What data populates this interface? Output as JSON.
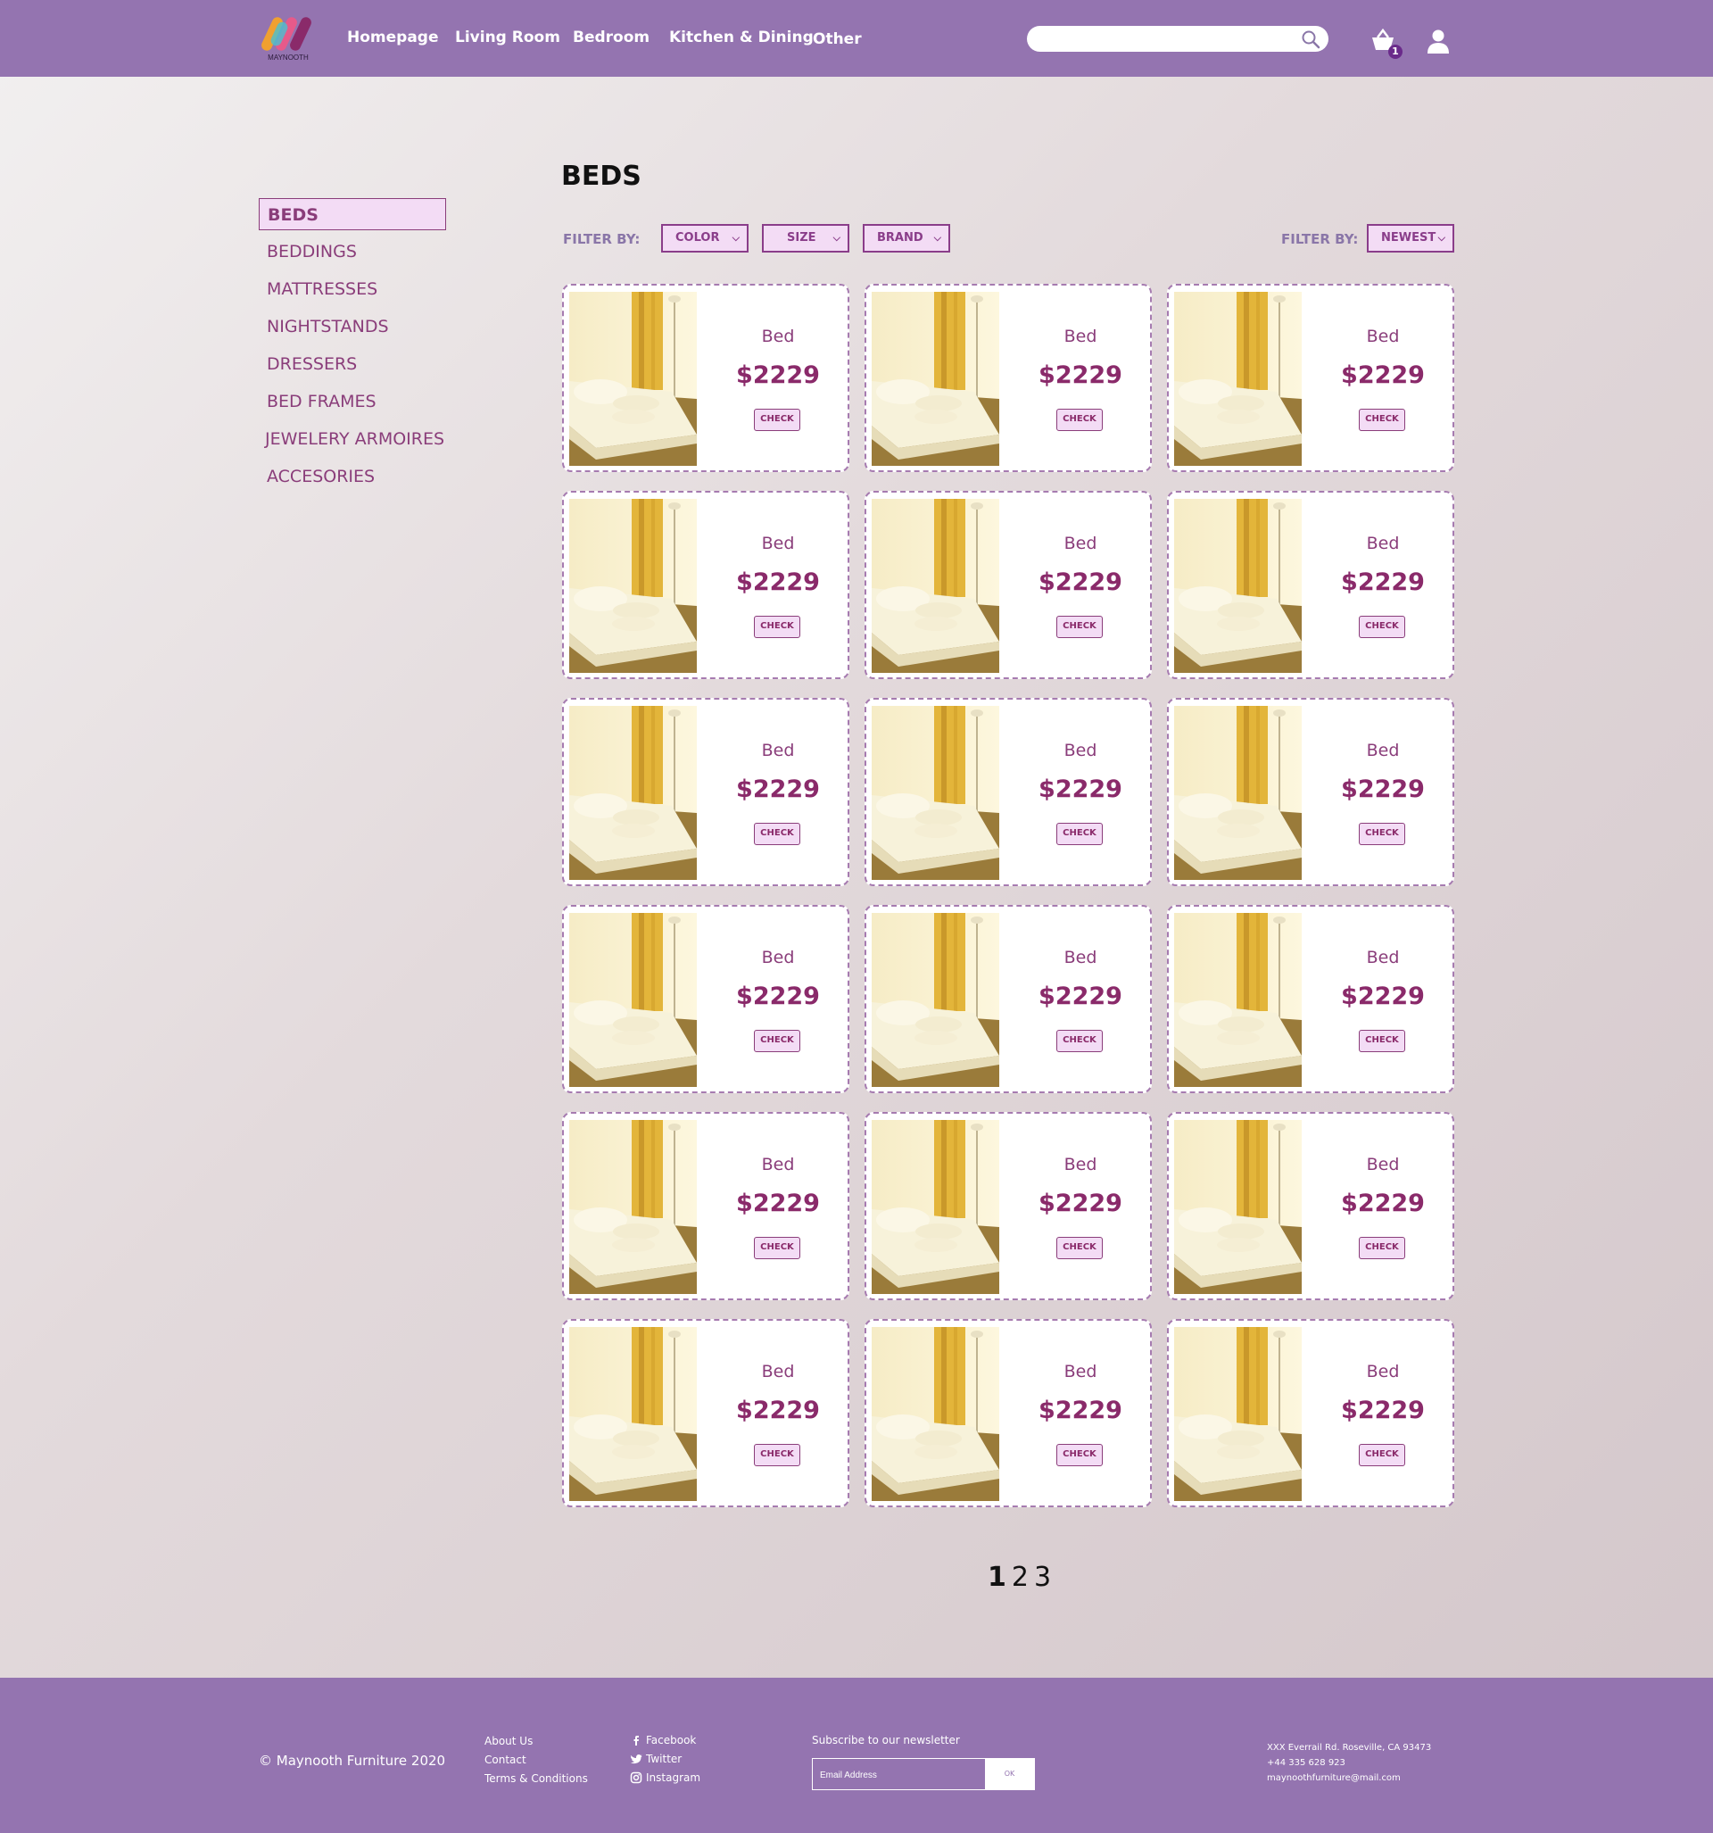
{
  "brand": {
    "name": "MAYNOOTH"
  },
  "nav": [
    {
      "label": "Homepage"
    },
    {
      "label": "Living Room"
    },
    {
      "label": "Bedroom"
    },
    {
      "label": "Kitchen & Dining"
    },
    {
      "label": "Other"
    }
  ],
  "search": {
    "placeholder": ""
  },
  "cart": {
    "count": "1"
  },
  "sidebar": {
    "items": [
      {
        "label": "BEDS",
        "active": true
      },
      {
        "label": "BEDDINGS"
      },
      {
        "label": "MATTRESSES"
      },
      {
        "label": "NIGHTSTANDS"
      },
      {
        "label": "DRESSERS"
      },
      {
        "label": "BED FRAMES"
      },
      {
        "label": "JEWELERY ARMOIRES"
      },
      {
        "label": "ACCESORIES"
      }
    ]
  },
  "main": {
    "title": "BEDS",
    "filter_label": "FILTER BY:",
    "filters": [
      {
        "label": "COLOR"
      },
      {
        "label": "SIZE"
      },
      {
        "label": "BRAND"
      }
    ],
    "sort_label": "FILTER BY:",
    "sort": {
      "label": "NEWEST"
    }
  },
  "products": [
    {
      "name": "Bed",
      "price": "$2229",
      "button": "CHECK"
    },
    {
      "name": "Bed",
      "price": "$2229",
      "button": "CHECK"
    },
    {
      "name": "Bed",
      "price": "$2229",
      "button": "CHECK"
    },
    {
      "name": "Bed",
      "price": "$2229",
      "button": "CHECK"
    },
    {
      "name": "Bed",
      "price": "$2229",
      "button": "CHECK"
    },
    {
      "name": "Bed",
      "price": "$2229",
      "button": "CHECK"
    },
    {
      "name": "Bed",
      "price": "$2229",
      "button": "CHECK"
    },
    {
      "name": "Bed",
      "price": "$2229",
      "button": "CHECK"
    },
    {
      "name": "Bed",
      "price": "$2229",
      "button": "CHECK"
    },
    {
      "name": "Bed",
      "price": "$2229",
      "button": "CHECK"
    },
    {
      "name": "Bed",
      "price": "$2229",
      "button": "CHECK"
    },
    {
      "name": "Bed",
      "price": "$2229",
      "button": "CHECK"
    },
    {
      "name": "Bed",
      "price": "$2229",
      "button": "CHECK"
    },
    {
      "name": "Bed",
      "price": "$2229",
      "button": "CHECK"
    },
    {
      "name": "Bed",
      "price": "$2229",
      "button": "CHECK"
    },
    {
      "name": "Bed",
      "price": "$2229",
      "button": "CHECK"
    },
    {
      "name": "Bed",
      "price": "$2229",
      "button": "CHECK"
    },
    {
      "name": "Bed",
      "price": "$2229",
      "button": "CHECK"
    }
  ],
  "pagination": {
    "pages": [
      "1",
      "2",
      "3"
    ],
    "current": "1"
  },
  "footer": {
    "copyright": "© Maynooth Furniture 2020",
    "links": [
      "About Us",
      "Contact",
      "Terms & Conditions"
    ],
    "social": [
      {
        "label": "Facebook",
        "icon": "facebook-icon"
      },
      {
        "label": "Twitter",
        "icon": "twitter-icon"
      },
      {
        "label": "Instagram",
        "icon": "instagram-icon"
      }
    ],
    "newsletter_label": "Subscribe to our newsletter",
    "email_placeholder": "Email Address",
    "ok_label": "OK",
    "address": [
      "XXX Everrail Rd. Roseville, CA 93473",
      "+44 335 628 923",
      "maynoothfurniture@mail.com"
    ]
  },
  "colors": {
    "header_bg": "#9474b0",
    "accent": "#8a2a6a",
    "active_bg": "#f3dcf5"
  }
}
